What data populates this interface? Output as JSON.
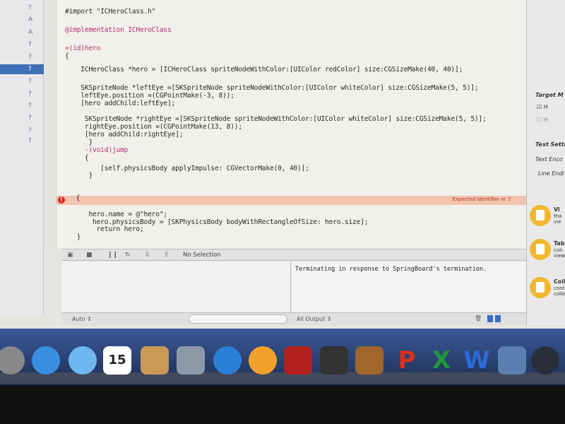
{
  "navigator": {
    "rows": [
      {
        "status": "?"
      },
      {
        "status": "A"
      },
      {
        "status": "A"
      },
      {
        "status": "?"
      },
      {
        "status": "?"
      },
      {
        "status": "?",
        "selected": true
      },
      {
        "status": "?"
      },
      {
        "status": "?"
      },
      {
        "status": "?"
      },
      {
        "status": "?"
      },
      {
        "status": "?"
      },
      {
        "status": "?"
      }
    ]
  },
  "editor": {
    "lines": [
      "#import \"ICHeroClass.h\"",
      "@implementation ICHeroClass",
      "+(id)hero",
      "{",
      "    ICHeroClass *hero = [ICHeroClass spriteNodeWithColor:[UIColor redColor] size:CGSizeMake(40, 40)];",
      "    SKSpriteNode *leftEye =[SKSpriteNode spriteNodeWithColor:[UIColor whiteColor] size:CGSizeMake(5, 5)];",
      "    leftEye.position =(CGPointMake(-3, 8));",
      "    [hero addChild:leftEye];",
      "     SKSpriteNode *rightEye =[SKSpriteNode spriteNodeWithColor:[UIColor whiteColor] size:CGSizeMake(5, 5)];",
      "     rightEye.position =(CGPointMake(13, 8));",
      "     [hero addChild:rightEye];",
      "      }",
      "     -(void)jump",
      "     {",
      "         [self.physicsBody applyImpulse: CGVectorMake(0, 40)];",
      "      }",
      " { ",
      "      hero.name = @\"hero\";",
      "       hero.physicsBody = [SKPhysicsBody bodyWithRectangleOfSize: hero.size];",
      "        return hero;",
      "   }"
    ],
    "error_message": "Expected identifier or '('",
    "error_color": "#d8281c"
  },
  "debug": {
    "selection": "No Selection",
    "console_output": "Terminating in response to SpringBoard's termination.",
    "vars_scope": "Auto ↕",
    "output_filter": "All Output ↕"
  },
  "inspector": {
    "target_membership": "Target M",
    "targets": [
      {
        "label": "H",
        "checked": true
      },
      {
        "label": "H",
        "checked": false
      }
    ],
    "text_settings": "Text Settin",
    "text_encoding": "Text Enco",
    "line_endings": "Line Endi",
    "library": [
      {
        "title": "Vi",
        "desc": [
          "tha",
          "vie"
        ]
      },
      {
        "title": "Tab",
        "desc": [
          "con",
          "view"
        ]
      },
      {
        "title": "Colle",
        "desc": [
          "contro",
          "collect"
        ]
      }
    ]
  },
  "dock": {
    "apps": [
      {
        "name": "finder",
        "color": "#888"
      },
      {
        "name": "safari",
        "color": "#3a8ee0"
      },
      {
        "name": "messages",
        "color": "#6fb7f0"
      },
      {
        "name": "calendar",
        "color": "#fff",
        "text": "15"
      },
      {
        "name": "contacts",
        "color": "#c99a55"
      },
      {
        "name": "iphoto",
        "color": "#8b9aa6"
      },
      {
        "name": "itunes",
        "color": "#2a7fd8"
      },
      {
        "name": "ibooks",
        "color": "#f3a02a"
      },
      {
        "name": "photo-booth",
        "color": "#b3201e"
      },
      {
        "name": "imovie",
        "color": "#333"
      },
      {
        "name": "garageband",
        "color": "#a0662a"
      },
      {
        "name": "powerpoint",
        "color": "#d8321f",
        "text": "P"
      },
      {
        "name": "excel",
        "color": "#1c9a3a",
        "text": "X"
      },
      {
        "name": "word",
        "color": "#2c6ad8",
        "text": "W"
      },
      {
        "name": "xcode",
        "color": "#5a7fb0"
      },
      {
        "name": "steam",
        "color": "#2a2e3a"
      }
    ]
  }
}
